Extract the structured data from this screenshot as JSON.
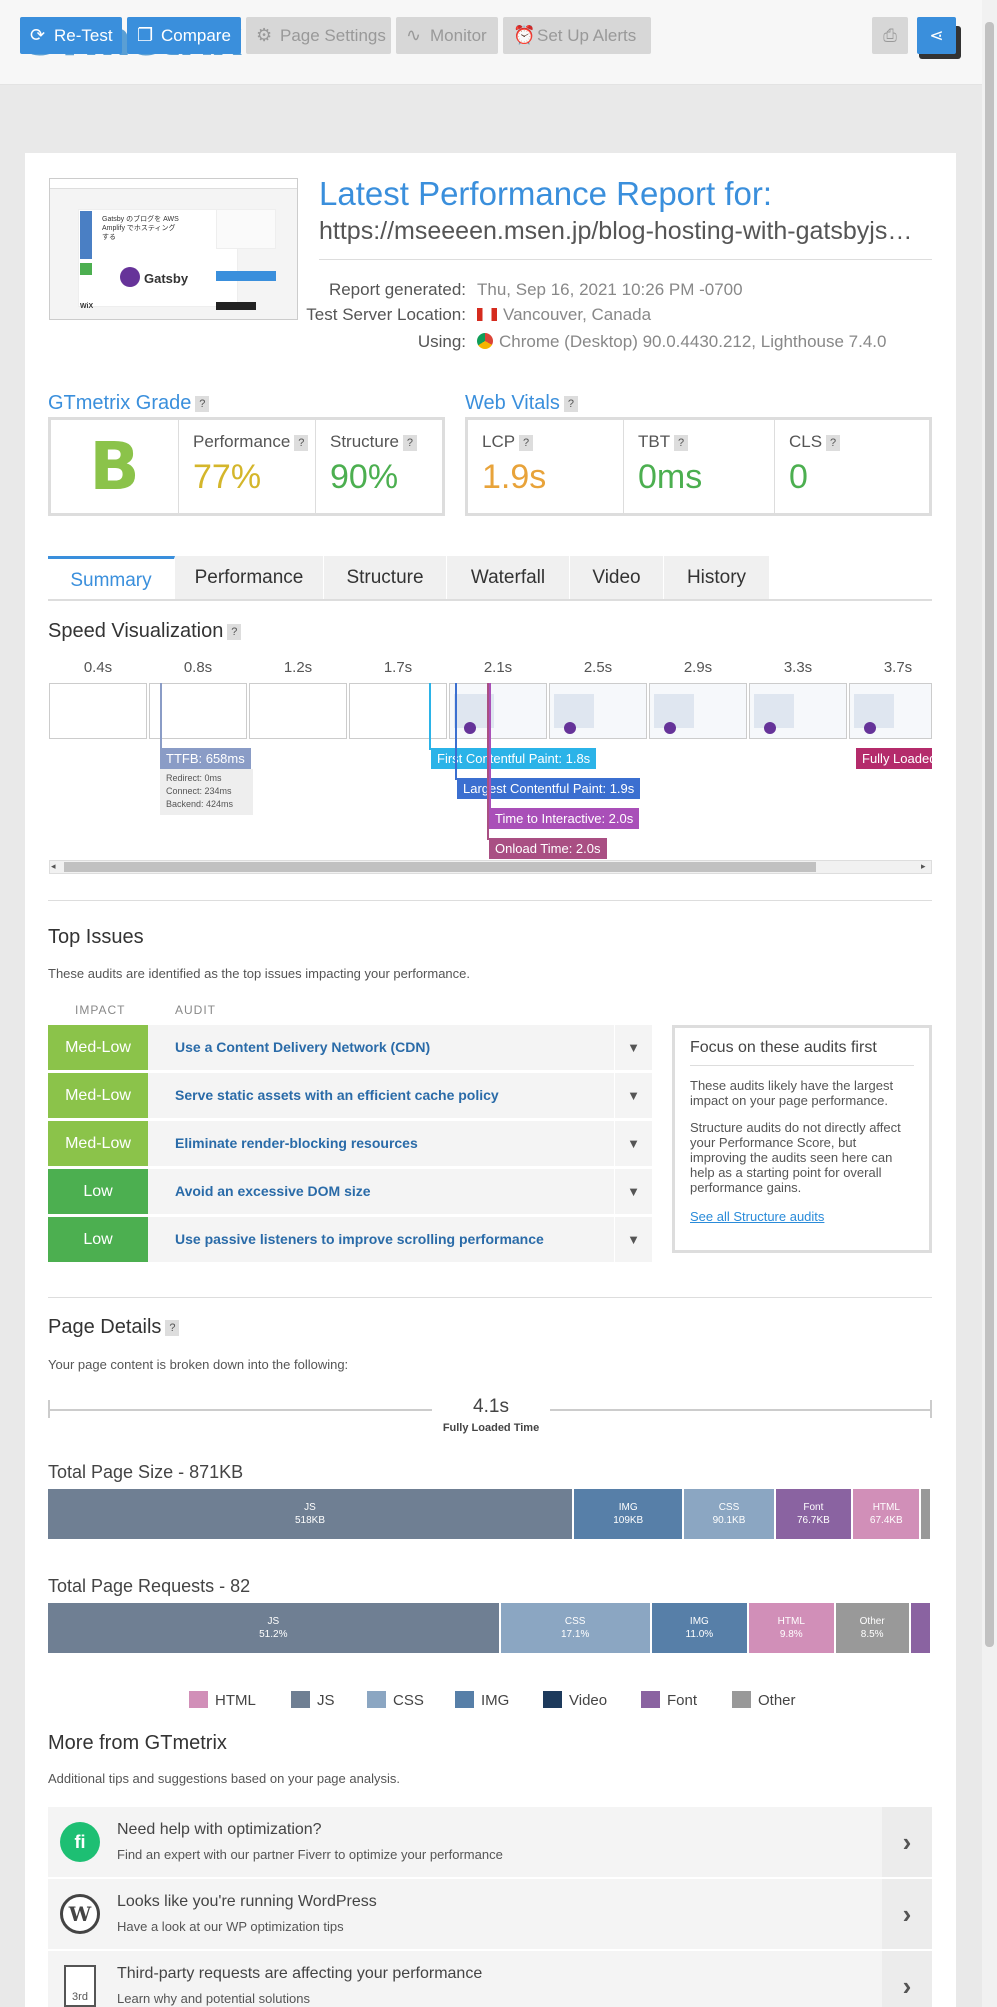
{
  "brand": {
    "logo": "GTmetrix"
  },
  "toolbar": {
    "retest": "Re-Test",
    "compare": "Compare",
    "page_settings": "Page Settings",
    "monitor": "Monitor",
    "alerts": "Set Up Alerts"
  },
  "report": {
    "title": "Latest Performance Report for:",
    "url": "https://mseeeen.msen.jp/blog-hosting-with-gatsbyjs…",
    "generated_label": "Report generated:",
    "generated": "Thu, Sep 16, 2021 10:26 PM -0700",
    "location_label": "Test Server Location:",
    "location": "Vancouver, Canada",
    "using_label": "Using:",
    "using": "Chrome (Desktop) 90.0.4430.212, Lighthouse 7.4.0"
  },
  "thumbnail": {
    "heading": "Gatsby のブログを AWS Amplify でホスティングする",
    "logo_text": "Gatsby",
    "wix": "WiX"
  },
  "grade": {
    "title": "GTmetrix Grade",
    "letter": "B",
    "performance_label": "Performance",
    "performance": "77%",
    "structure_label": "Structure",
    "structure": "90%"
  },
  "vitals": {
    "title": "Web Vitals",
    "lcp_label": "LCP",
    "lcp": "1.9s",
    "tbt_label": "TBT",
    "tbt": "0ms",
    "cls_label": "CLS",
    "cls": "0"
  },
  "tabs": [
    "Summary",
    "Performance",
    "Structure",
    "Waterfall",
    "Video",
    "History"
  ],
  "speed": {
    "title": "Speed Visualization",
    "ticks": [
      "0.4s",
      "0.8s",
      "1.2s",
      "1.7s",
      "2.1s",
      "2.5s",
      "2.9s",
      "3.3s",
      "3.7s"
    ],
    "ttfb": "TTFB: 658ms",
    "ttfb_redirect": "Redirect: 0ms",
    "ttfb_connect": "Connect: 234ms",
    "ttfb_backend": "Backend: 424ms",
    "fcp": "First Contentful Paint: 1.8s",
    "lcp": "Largest Contentful Paint: 1.9s",
    "tti": "Time to Interactive: 2.0s",
    "onload": "Onload Time: 2.0s",
    "fully": "Fully Loaded"
  },
  "issues": {
    "title": "Top Issues",
    "subtitle": "These audits are identified as the top issues impacting your performance.",
    "col_impact": "IMPACT",
    "col_audit": "AUDIT",
    "rows": [
      {
        "impact": "Med-Low",
        "audit": "Use a Content Delivery Network (CDN)"
      },
      {
        "impact": "Med-Low",
        "audit": "Serve static assets with an efficient cache policy"
      },
      {
        "impact": "Med-Low",
        "audit": "Eliminate render-blocking resources"
      },
      {
        "impact": "Low",
        "audit": "Avoid an excessive DOM size"
      },
      {
        "impact": "Low",
        "audit": "Use passive listeners to improve scrolling performance"
      }
    ],
    "focus_title": "Focus on these audits first",
    "focus_p1": "These audits likely have the largest impact on your page performance.",
    "focus_p2": "Structure audits do not directly affect your Performance Score, but improving the audits seen here can help as a starting point for overall performance gains.",
    "focus_link": "See all Structure audits"
  },
  "details": {
    "title": "Page Details",
    "subtitle": "Your page content is broken down into the following:",
    "fully_loaded": "4.1s",
    "fully_loaded_label": "Fully Loaded Time",
    "size_title": "Total Page Size - 871KB",
    "size_segments": [
      {
        "name": "JS",
        "value": "518KB",
        "share": 59.5,
        "color": "#6f7f93"
      },
      {
        "name": "IMG",
        "value": "109KB",
        "share": 12.5,
        "color": "#577fa8"
      },
      {
        "name": "CSS",
        "value": "90.1KB",
        "share": 10.3,
        "color": "#8ba6c2"
      },
      {
        "name": "Font",
        "value": "76.7KB",
        "share": 8.8,
        "color": "#8a63a1"
      },
      {
        "name": "HTML",
        "value": "67.4KB",
        "share": 7.7,
        "color": "#d18fb8"
      },
      {
        "name": "",
        "value": "",
        "share": 1.2,
        "color": "#999999"
      }
    ],
    "req_title": "Total Page Requests - 82",
    "req_segments": [
      {
        "name": "JS",
        "value": "51.2%",
        "share": 51.2,
        "color": "#6f7f93"
      },
      {
        "name": "CSS",
        "value": "17.1%",
        "share": 17.1,
        "color": "#8ba6c2"
      },
      {
        "name": "IMG",
        "value": "11.0%",
        "share": 11.0,
        "color": "#577fa8"
      },
      {
        "name": "HTML",
        "value": "9.8%",
        "share": 9.8,
        "color": "#d18fb8"
      },
      {
        "name": "Other",
        "value": "8.5%",
        "share": 8.5,
        "color": "#999999"
      },
      {
        "name": "",
        "value": "",
        "share": 2.4,
        "color": "#8a63a1"
      }
    ],
    "legend": [
      {
        "label": "HTML",
        "color": "#d18fb8"
      },
      {
        "label": "JS",
        "color": "#6f7f93"
      },
      {
        "label": "CSS",
        "color": "#8ba6c2"
      },
      {
        "label": "IMG",
        "color": "#577fa8"
      },
      {
        "label": "Video",
        "color": "#1d3a5c"
      },
      {
        "label": "Font",
        "color": "#8a63a1"
      },
      {
        "label": "Other",
        "color": "#999999"
      }
    ]
  },
  "more": {
    "title": "More from GTmetrix",
    "subtitle": "Additional tips and suggestions based on your page analysis.",
    "items": [
      {
        "title": "Need help with optimization?",
        "sub": "Find an expert with our partner Fiverr to optimize your performance",
        "icon": "fi"
      },
      {
        "title": "Looks like you're running WordPress",
        "sub": "Have a look at our WP optimization tips",
        "icon": "W"
      },
      {
        "title": "Third-party requests are affecting your performance",
        "sub": "Learn why and potential solutions",
        "icon": "3rd"
      }
    ]
  }
}
